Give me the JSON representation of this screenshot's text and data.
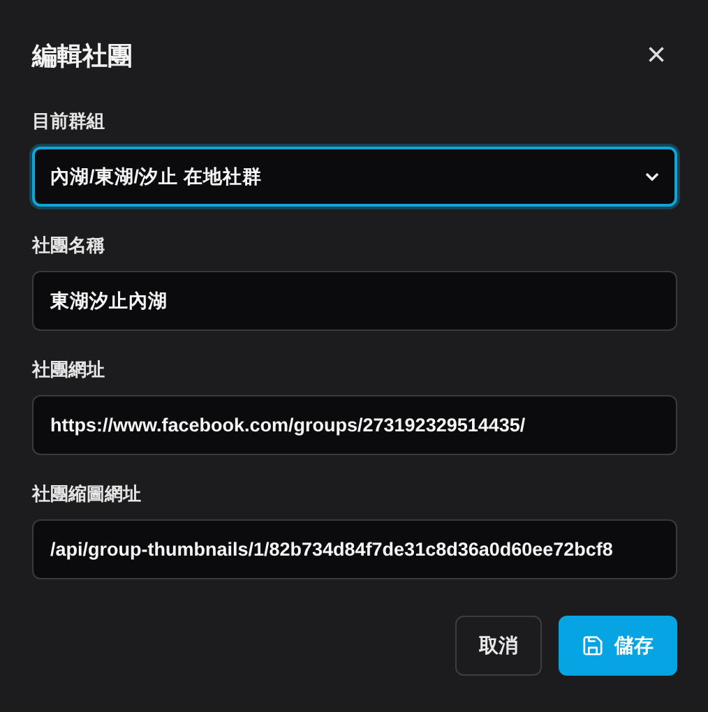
{
  "dialog": {
    "title": "編輯社團",
    "close": "×"
  },
  "fields": [
    {
      "kind": "select",
      "label": "目前群組",
      "value": "內湖/東湖/汐止 在地社群",
      "focused": true
    },
    {
      "kind": "text",
      "label": "社團名稱",
      "value": "東湖汐止內湖",
      "focused": false
    },
    {
      "kind": "text",
      "label": "社團網址",
      "value": "https://www.facebook.com/groups/273192329514435/",
      "focused": false
    },
    {
      "kind": "text",
      "label": "社團縮圖網址",
      "value": "/api/group-thumbnails/1/82b734d84f7de31c8d36a0d60ee72bcf8",
      "focused": false
    }
  ],
  "buttons": [
    {
      "kind": "secondary",
      "label": "取消"
    },
    {
      "kind": "primary",
      "label": "儲存"
    }
  ]
}
